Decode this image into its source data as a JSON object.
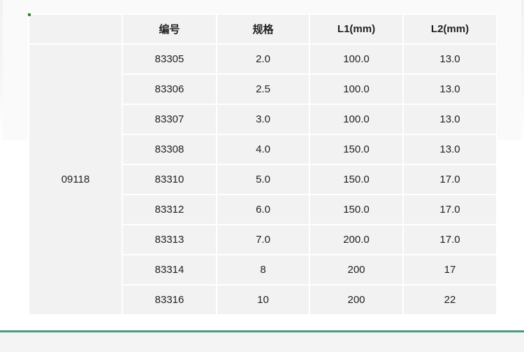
{
  "table": {
    "group_label": "09118",
    "headers": [
      "编号",
      "规格",
      "L1(mm)",
      "L2(mm)"
    ],
    "rows": [
      [
        "83305",
        "2.0",
        "100.0",
        "13.0"
      ],
      [
        "83306",
        "2.5",
        "100.0",
        "13.0"
      ],
      [
        "83307",
        "3.0",
        "100.0",
        "13.0"
      ],
      [
        "83308",
        "4.0",
        "150.0",
        "13.0"
      ],
      [
        "83310",
        "5.0",
        "150.0",
        "17.0"
      ],
      [
        "83312",
        "6.0",
        "150.0",
        "17.0"
      ],
      [
        "83313",
        "7.0",
        "200.0",
        "17.0"
      ],
      [
        "83314",
        "8",
        "200",
        "17"
      ],
      [
        "83316",
        "10",
        "200",
        "22"
      ]
    ]
  },
  "colors": {
    "cell_background": "#f2f2f2",
    "accent_line": "#4c9a7a",
    "corner_mark": "#2e8b3a"
  }
}
